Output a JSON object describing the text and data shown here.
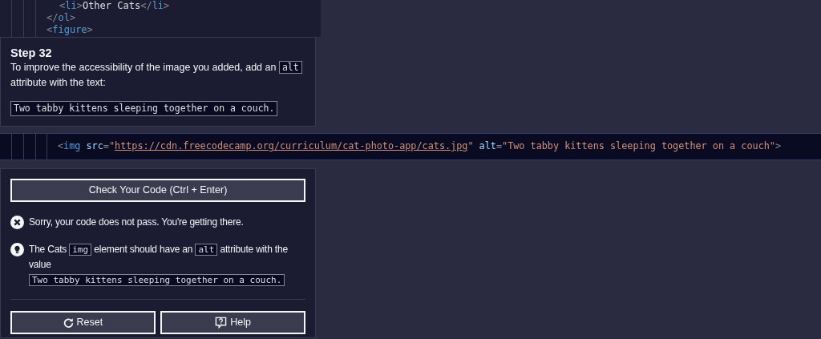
{
  "editor_top": {
    "lines": [
      [
        {
          "kind": "punct",
          "text": "<"
        },
        {
          "kind": "tag",
          "text": "li"
        },
        {
          "kind": "punct",
          "text": ">"
        },
        {
          "kind": "text",
          "text": "Other Cats"
        },
        {
          "kind": "punct",
          "text": "</"
        },
        {
          "kind": "tag",
          "text": "li"
        },
        {
          "kind": "punct",
          "text": ">"
        }
      ],
      [
        {
          "kind": "punct",
          "text": "</"
        },
        {
          "kind": "tag",
          "text": "ol"
        },
        {
          "kind": "punct",
          "text": ">"
        }
      ],
      [
        {
          "kind": "punct",
          "text": "<"
        },
        {
          "kind": "tag",
          "text": "figure"
        },
        {
          "kind": "punct",
          "text": ">"
        }
      ]
    ]
  },
  "step": {
    "title": "Step 32",
    "description": [
      {
        "kind": "text",
        "text": "To improve the accessibility of the image you added, add an"
      },
      {
        "kind": "code",
        "text": "alt"
      },
      {
        "kind": "text",
        "text": "attribute with the text:"
      }
    ],
    "code_block": "Two tabby kittens sleeping together on a couch."
  },
  "editor_line": [
    {
      "kind": "punct",
      "text": "<"
    },
    {
      "kind": "tag",
      "text": "img"
    },
    {
      "kind": "attr",
      "text": "src"
    },
    {
      "kind": "punct",
      "text": "="
    },
    {
      "kind": "string",
      "text": "\""
    },
    {
      "kind": "link",
      "text": "https://cdn.freecodecamp.org/curriculum/cat-photo-app/cats.jpg"
    },
    {
      "kind": "string",
      "text": "\""
    },
    {
      "kind": "attr",
      "text": "alt"
    },
    {
      "kind": "punct",
      "text": "="
    },
    {
      "kind": "string",
      "text": "\"Two tabby kittens sleeping together on a couch\""
    },
    {
      "kind": "punct",
      "text": ">"
    }
  ],
  "actions": {
    "check_button": "Check Your Code (Ctrl + Enter)",
    "messages": [
      {
        "kind": "error",
        "parts": [
          {
            "kind": "text",
            "text": "Sorry, your code does not pass. You're getting there."
          }
        ]
      },
      {
        "kind": "hint",
        "parts": [
          {
            "kind": "text",
            "text": "The Cats"
          },
          {
            "kind": "code",
            "text": "img"
          },
          {
            "kind": "text",
            "text": "element should have an"
          },
          {
            "kind": "code",
            "text": "alt"
          },
          {
            "kind": "text",
            "text": "attribute with the"
          },
          {
            "kind": "text",
            "text": "value"
          },
          {
            "kind": "code",
            "text": "Two tabby kittens sleeping together on a couch."
          }
        ]
      }
    ],
    "buttons": [
      {
        "kind": "reset",
        "label": "Reset"
      },
      {
        "kind": "help",
        "label": "Help"
      }
    ]
  }
}
